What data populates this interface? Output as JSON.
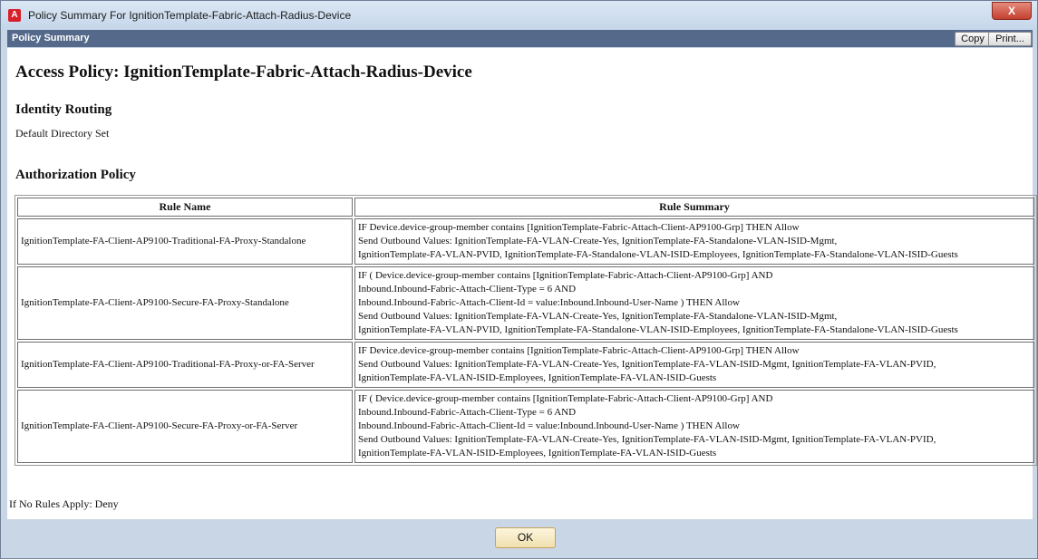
{
  "window": {
    "title": "Policy Summary For IgnitionTemplate-Fabric-Attach-Radius-Device",
    "app_icon": "A",
    "close_label": "X"
  },
  "panel": {
    "title": "Policy Summary",
    "copy_label": "Copy",
    "print_label": "Print..."
  },
  "content": {
    "heading": "Access Policy: IgnitionTemplate-Fabric-Attach-Radius-Device",
    "identity_heading": "Identity Routing",
    "identity_text": "Default Directory Set",
    "auth_heading": "Authorization Policy",
    "columns": [
      "Rule Name",
      "Rule Summary"
    ],
    "rules": [
      {
        "name": "IgnitionTemplate-FA-Client-AP9100-Traditional-FA-Proxy-Standalone",
        "summary": [
          "IF Device.device-group-member contains [IgnitionTemplate-Fabric-Attach-Client-AP9100-Grp] THEN Allow",
          "Send Outbound Values: IgnitionTemplate-FA-VLAN-Create-Yes, IgnitionTemplate-FA-Standalone-VLAN-ISID-Mgmt,",
          "IgnitionTemplate-FA-VLAN-PVID, IgnitionTemplate-FA-Standalone-VLAN-ISID-Employees, IgnitionTemplate-FA-Standalone-VLAN-ISID-Guests"
        ]
      },
      {
        "name": "IgnitionTemplate-FA-Client-AP9100-Secure-FA-Proxy-Standalone",
        "summary": [
          "IF ( Device.device-group-member contains [IgnitionTemplate-Fabric-Attach-Client-AP9100-Grp] AND",
          "Inbound.Inbound-Fabric-Attach-Client-Type = 6 AND",
          "Inbound.Inbound-Fabric-Attach-Client-Id = value:Inbound.Inbound-User-Name ) THEN Allow",
          "Send Outbound Values: IgnitionTemplate-FA-VLAN-Create-Yes, IgnitionTemplate-FA-Standalone-VLAN-ISID-Mgmt,",
          "IgnitionTemplate-FA-VLAN-PVID, IgnitionTemplate-FA-Standalone-VLAN-ISID-Employees, IgnitionTemplate-FA-Standalone-VLAN-ISID-Guests"
        ]
      },
      {
        "name": "IgnitionTemplate-FA-Client-AP9100-Traditional-FA-Proxy-or-FA-Server",
        "summary": [
          "IF Device.device-group-member contains [IgnitionTemplate-Fabric-Attach-Client-AP9100-Grp] THEN Allow",
          "Send Outbound Values: IgnitionTemplate-FA-VLAN-Create-Yes, IgnitionTemplate-FA-VLAN-ISID-Mgmt, IgnitionTemplate-FA-VLAN-PVID,",
          "IgnitionTemplate-FA-VLAN-ISID-Employees, IgnitionTemplate-FA-VLAN-ISID-Guests"
        ]
      },
      {
        "name": "IgnitionTemplate-FA-Client-AP9100-Secure-FA-Proxy-or-FA-Server",
        "summary": [
          "IF ( Device.device-group-member contains [IgnitionTemplate-Fabric-Attach-Client-AP9100-Grp] AND",
          "Inbound.Inbound-Fabric-Attach-Client-Type = 6 AND",
          "Inbound.Inbound-Fabric-Attach-Client-Id = value:Inbound.Inbound-User-Name ) THEN Allow",
          "Send Outbound Values: IgnitionTemplate-FA-VLAN-Create-Yes, IgnitionTemplate-FA-VLAN-ISID-Mgmt, IgnitionTemplate-FA-VLAN-PVID,",
          "IgnitionTemplate-FA-VLAN-ISID-Employees, IgnitionTemplate-FA-VLAN-ISID-Guests"
        ]
      }
    ],
    "default_rule": "If No Rules Apply: Deny"
  },
  "footer": {
    "ok_label": "OK"
  }
}
